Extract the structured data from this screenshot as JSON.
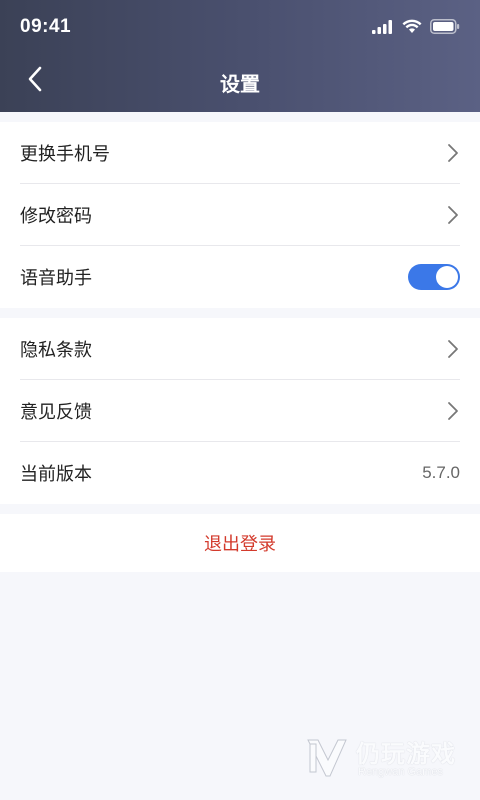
{
  "status_bar": {
    "time": "09:41"
  },
  "nav": {
    "title": "设置"
  },
  "settings": {
    "group1": [
      {
        "label": "更换手机号",
        "control": "chevron-right-icon"
      },
      {
        "label": "修改密码",
        "control": "chevron-right-icon"
      },
      {
        "label": "语音助手",
        "control": "toggle",
        "toggle_on": true
      }
    ],
    "group2": [
      {
        "label": "隐私条款",
        "control": "chevron-right-icon"
      },
      {
        "label": "意见反馈",
        "control": "chevron-right-icon"
      },
      {
        "label": "当前版本",
        "value": "5.7.0"
      }
    ],
    "logout_label": "退出登录"
  },
  "watermark": {
    "cn": "仍玩游戏",
    "en": "Rengwan Games"
  },
  "colors": {
    "header_start": "#3b4156",
    "header_end": "#5b6184",
    "toggle_on": "#3b78e8",
    "logout": "#d33a2c",
    "page_bg": "#f6f7fb"
  }
}
